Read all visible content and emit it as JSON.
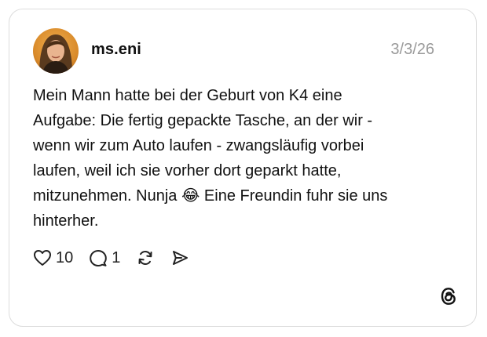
{
  "post": {
    "username": "ms.eni",
    "date": "3/3/26",
    "text": "Mein Mann hatte bei der Geburt von K4 eine\nAufgabe: Die fertig gepackte Tasche, an der wir -\nwenn wir zum Auto laufen - zwangsläufig vorbei\nlaufen, weil ich sie vorher dort geparkt hatte,\nmitzunehmen. Nunja 😂 Eine Freundin fuhr sie uns\nhinterher."
  },
  "actions": {
    "likes": "10",
    "replies": "1",
    "like_icon": "heart-icon",
    "reply_icon": "speech-bubble-icon",
    "repost_icon": "repost-icon",
    "share_icon": "send-icon"
  },
  "brand": {
    "logo_icon": "threads-logo-icon",
    "accent": "#111111",
    "muted": "#9a9a9a",
    "border": "#dcdcdc"
  }
}
